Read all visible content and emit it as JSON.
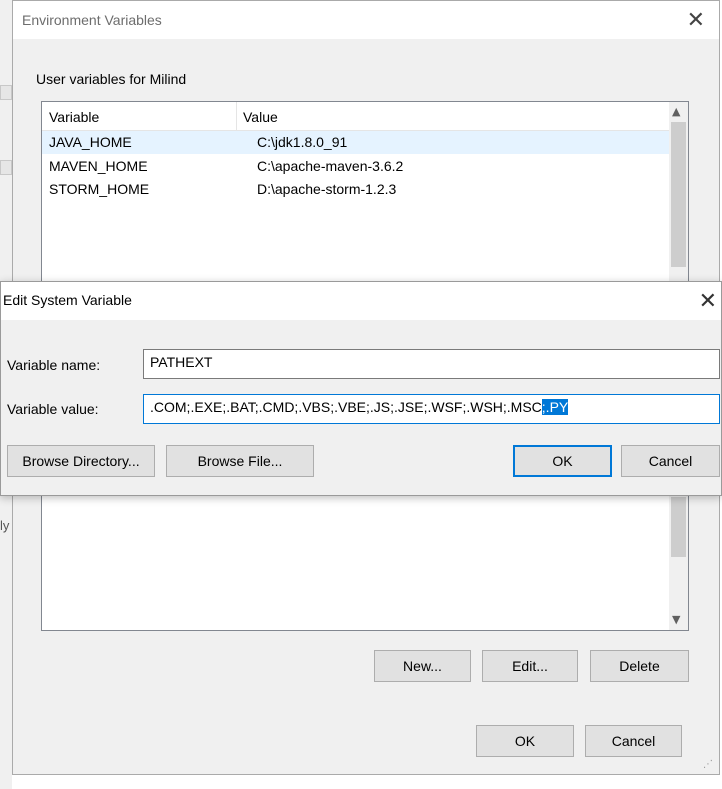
{
  "background": {
    "fragment_text": "ly"
  },
  "env_window": {
    "title": "Environment Variables",
    "close_glyph": "✕",
    "user_group_label": "User variables for Milind",
    "columns": {
      "variable": "Variable",
      "value": "Value"
    },
    "user_vars": [
      {
        "variable": "JAVA_HOME",
        "value": "C:\\jdk1.8.0_91",
        "selected": true
      },
      {
        "variable": "MAVEN_HOME",
        "value": "C:\\apache-maven-3.6.2"
      },
      {
        "variable": "STORM_HOME",
        "value": "D:\\apache-storm-1.2.3"
      }
    ],
    "buttons": {
      "new": "New...",
      "edit": "Edit...",
      "delete": "Delete"
    },
    "footer": {
      "ok": "OK",
      "cancel": "Cancel"
    }
  },
  "edit_dialog": {
    "title": "Edit System Variable",
    "close_glyph": "✕",
    "name_label": "Variable name:",
    "name_value": "PATHEXT",
    "value_label": "Variable value:",
    "value_text": ".COM;.EXE;.BAT;.CMD;.VBS;.VBE;.JS;.JSE;.WSF;.WSH;.MSC",
    "value_selected": ";.PY",
    "buttons": {
      "browse_directory": "Browse Directory...",
      "browse_file": "Browse File...",
      "ok": "OK",
      "cancel": "Cancel"
    }
  },
  "icons": {
    "scroll_up": "chevron-up-icon",
    "scroll_down": "chevron-down-icon",
    "resize": "resize-grip-icon"
  },
  "colors": {
    "accent": "#0078d7",
    "selection_row": "#e5f3ff",
    "window_bg": "#f0f0f0"
  }
}
